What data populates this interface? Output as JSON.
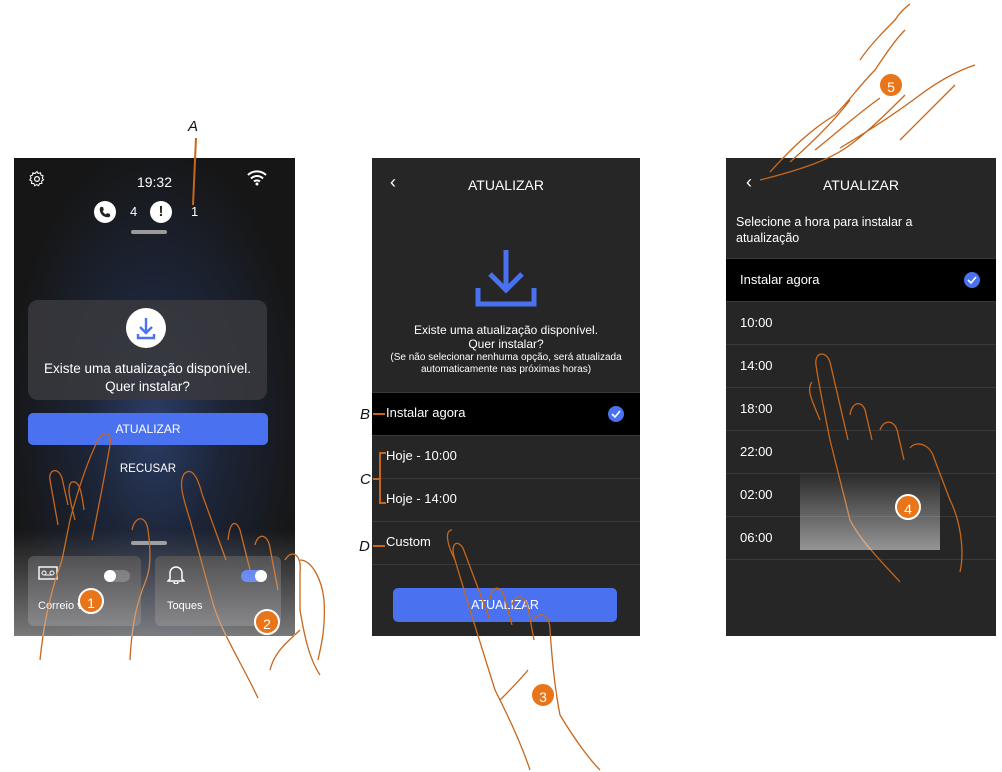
{
  "screen1": {
    "time": "19:32",
    "missed_calls": "4",
    "alerts": "1",
    "update_msg": "Existe uma atualização disponível. Quer instalar?",
    "update_button": "ATUALIZAR",
    "refuse_button": "RECUSAR",
    "tile_left_label": "Correio voz",
    "tile_right_label": "Toques"
  },
  "screen2": {
    "title": "ATUALIZAR",
    "msg_line1": "Existe uma atualização disponível.",
    "msg_line2": "Quer instalar?",
    "msg_line3": "(Se não selecionar nenhuma opção, será atualizada",
    "msg_line4": "automaticamente nas próximas horas)",
    "options": [
      "Instalar agora",
      "Hoje - 10:00",
      "Hoje - 14:00",
      "Custom"
    ],
    "button": "ATUALIZAR"
  },
  "screen3": {
    "title": "ATUALIZAR",
    "prompt": "Selecione a hora para instalar a atualização",
    "options": [
      "Instalar agora",
      "10:00",
      "14:00",
      "18:00",
      "22:00",
      "02:00",
      "06:00"
    ]
  },
  "callouts": {
    "A": "A",
    "B": "B",
    "C": "C",
    "D": "D",
    "steps": [
      "1",
      "2",
      "3",
      "4",
      "5"
    ]
  },
  "colors": {
    "accent": "#4a72f0",
    "callout": "#e8751a",
    "screen_bg": "#262626"
  }
}
